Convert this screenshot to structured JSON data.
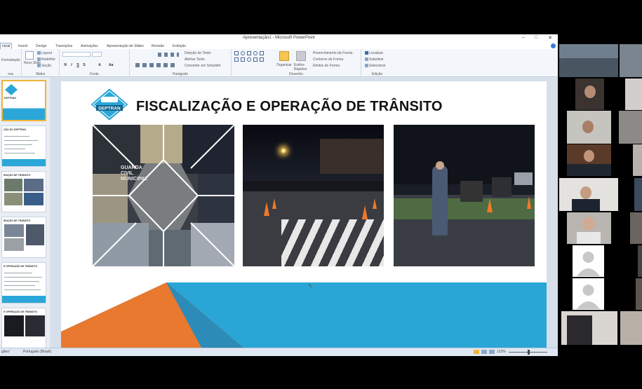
{
  "window": {
    "title": "Apresentação1 - Microsoft PowerPoint",
    "controls": [
      "–",
      "□",
      "✕"
    ]
  },
  "ribbon_tabs": [
    {
      "label": "nicial",
      "active": true
    },
    {
      "label": "Inserir"
    },
    {
      "label": "Design"
    },
    {
      "label": "Transições"
    },
    {
      "label": "Animações"
    },
    {
      "label": "Apresentação de Slides"
    },
    {
      "label": "Revisão"
    },
    {
      "label": "Exibição"
    }
  ],
  "ribbon": {
    "groups": [
      "rea",
      "Slides",
      "Fonte",
      "Parágrafo",
      "Desenho",
      "Edição"
    ],
    "slides": {
      "novo_slide": "Novo Slide",
      "layout": "Layout",
      "redefinir": "Redefinir",
      "secao": "Seção"
    },
    "formatacao": "Formatação",
    "paragraph": {
      "direcao": "Direção do Texto",
      "alinhar": "Alinhar Texto",
      "converter": "Converter em SmartArt"
    },
    "drawing": {
      "organizar": "Organizar",
      "estilos": "Estilos Rápidos",
      "preenchimento": "Preenchimento da Forma",
      "contorno": "Contorno da Forma",
      "efeitos": "Efeitos de Forma"
    },
    "editing": {
      "localizar": "Localizar",
      "substituir": "Substituir",
      "selecionar": "Selecionar"
    }
  },
  "slide": {
    "title": "FISCALIZAÇÃO E OPERAÇÃO DE TRÂNSITO",
    "logo_text": "DEPTRAN",
    "photo1_text": "GUARDA CIVIL MUNICIPAL"
  },
  "thumbnails": [
    {
      "title": "DEPTRAN"
    },
    {
      "title": "ÇÃO DO DEPTRAN"
    },
    {
      "title": "IRAÇÃO   DE TRÂNSITO"
    },
    {
      "title": "IRAÇÃO   DE TRÂNSITO"
    },
    {
      "title": "E OPERAÇÃO DE TRÂNSITO"
    },
    {
      "title": "E OPERAÇÃO DE TRÂNSITO"
    }
  ],
  "statusbar": {
    "left": "gões\"",
    "language": "Português (Brasil)",
    "zoom": "123%"
  },
  "colors": {
    "accent_blue": "#2aa6d6",
    "accent_orange": "#e8792f",
    "ribbon_bg": "#f3f6fa"
  }
}
